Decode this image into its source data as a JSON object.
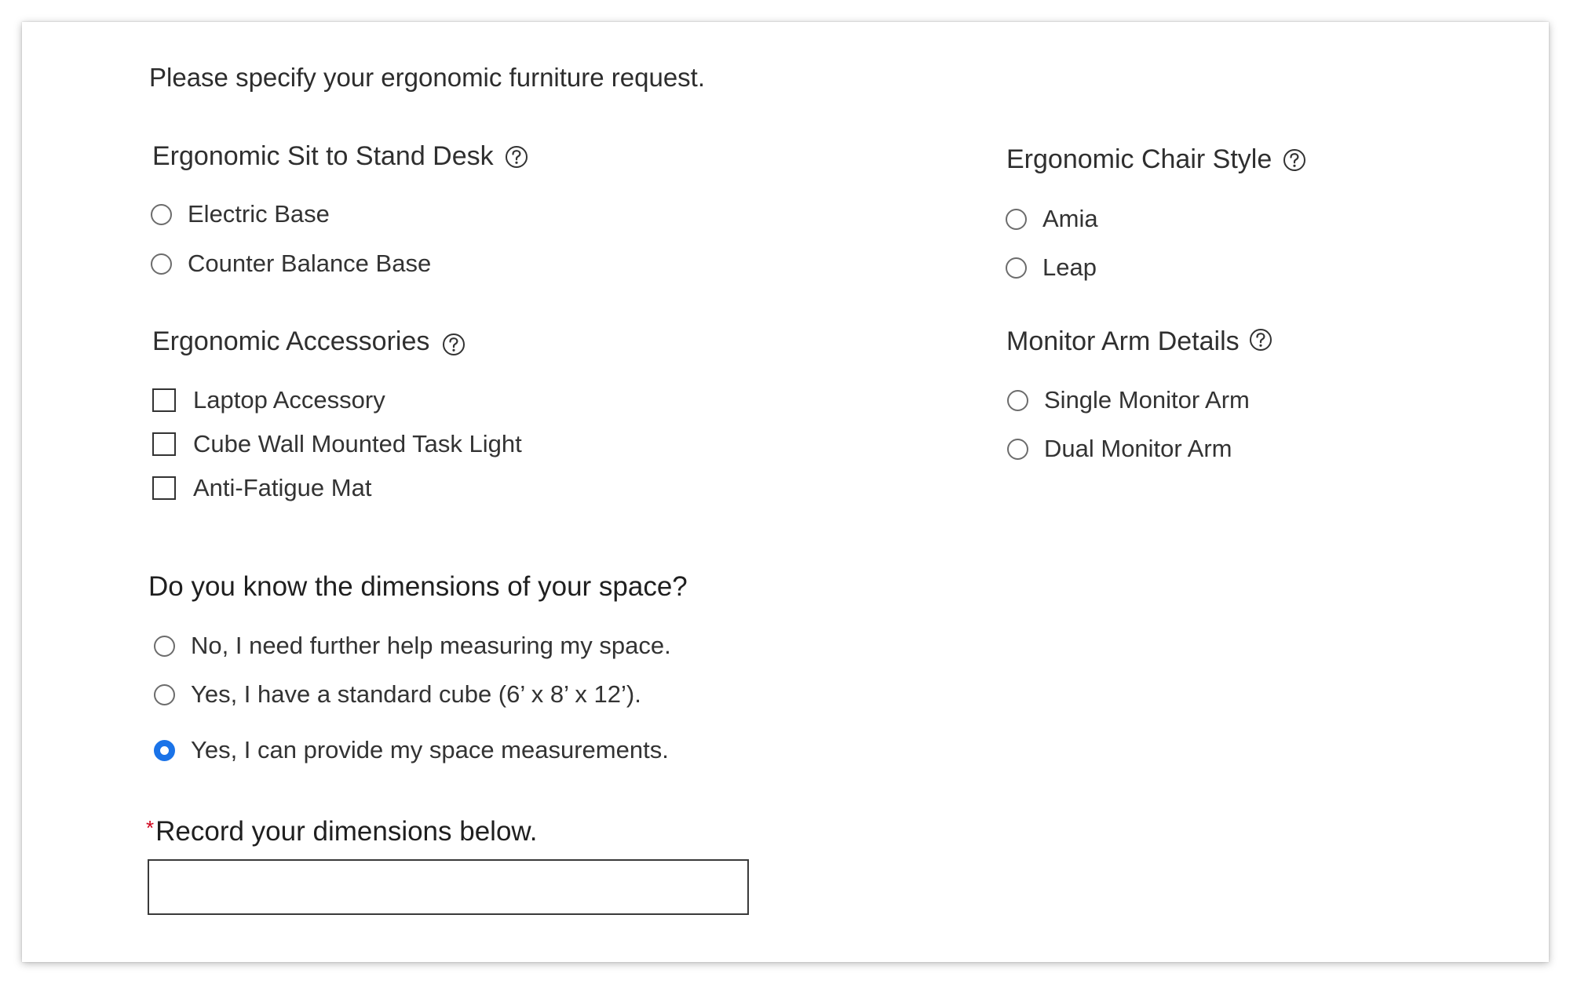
{
  "intro_text": "Please specify your ergonomic furniture request.",
  "desk": {
    "title": "Ergonomic Sit to Stand Desk",
    "options": [
      "Electric Base",
      "Counter Balance Base"
    ]
  },
  "chair": {
    "title": "Ergonomic Chair Style",
    "options": [
      "Amia",
      "Leap"
    ]
  },
  "accessories": {
    "title": "Ergonomic Accessories",
    "options": [
      "Laptop Accessory",
      "Cube Wall Mounted Task Light",
      "Anti-Fatigue Mat"
    ]
  },
  "monitor": {
    "title": "Monitor Arm Details",
    "options": [
      "Single Monitor Arm",
      "Dual Monitor Arm"
    ]
  },
  "dimensions": {
    "question": "Do you know the dimensions of your space?",
    "options": [
      "No, I need further help measuring my space.",
      "Yes, I have a standard cube (6’ x 8’ x 12’).",
      "Yes, I can provide my space measurements."
    ],
    "selected": "Yes, I can provide my space measurements."
  },
  "record": {
    "required_marker": "*",
    "label": "Record your dimensions below.",
    "value": ""
  },
  "icons": {
    "help": "question-circle-icon"
  },
  "colors": {
    "accent": "#1a73e8",
    "required": "#d0021b"
  }
}
